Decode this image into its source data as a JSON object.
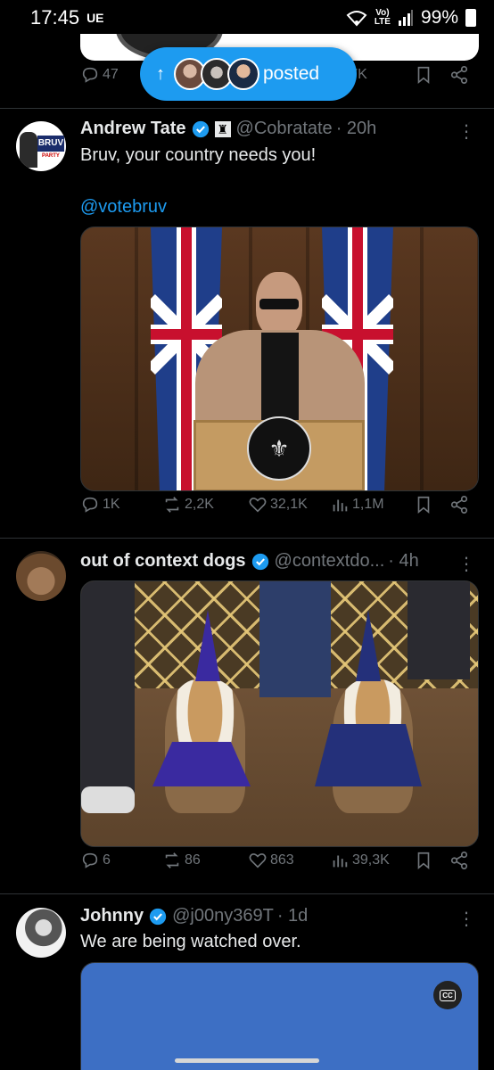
{
  "status_bar": {
    "time": "17:45",
    "carrier": "UE",
    "network_top": "Vo)",
    "network_bottom": "LTE",
    "battery": "99%"
  },
  "partial_tweet": {
    "reply_count": "47",
    "views": "32,7K"
  },
  "new_posts_pill": {
    "label": "posted",
    "arrow": "↑"
  },
  "tweets": [
    {
      "name": "Andrew Tate",
      "handle": "@Cobratate",
      "time": "· 20h",
      "text": "Bruv, your country needs you!",
      "link": "@votebruv",
      "avatar_text": "BRUV",
      "avatar_sub": "PARTY",
      "replies": "1K",
      "reposts": "2,2K",
      "likes": "32,1K",
      "views": "1,1M"
    },
    {
      "name": "out of context dogs",
      "handle": "@contextdo...",
      "time": "· 4h",
      "replies": "6",
      "reposts": "86",
      "likes": "863",
      "views": "39,3K"
    },
    {
      "name": "Johnny",
      "handle": "@j00ny369T",
      "time": "· 1d",
      "text": "We are being watched over.",
      "cc_label": "CC"
    }
  ],
  "colors": {
    "accent": "#1d9bf0",
    "muted": "#71767b",
    "text": "#e7e9ea",
    "background": "#000000",
    "divider": "#2f3336"
  }
}
